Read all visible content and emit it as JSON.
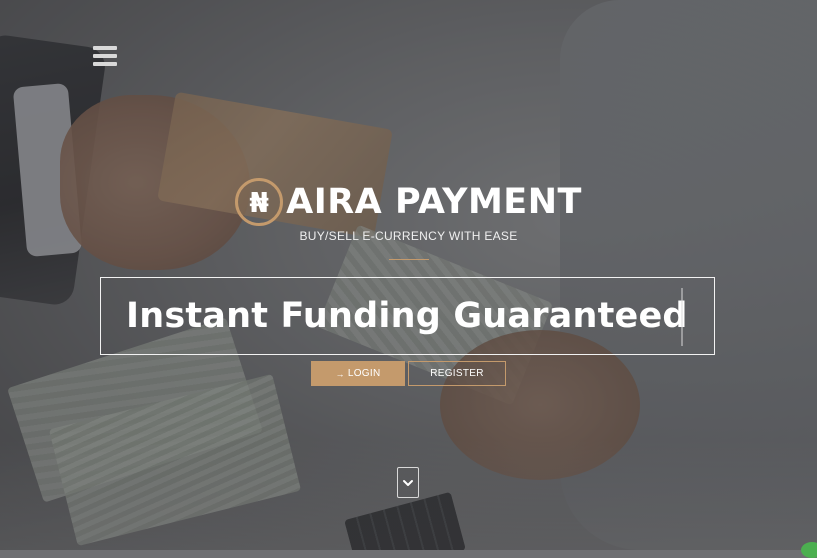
{
  "brand": {
    "logo_glyph": "₦",
    "name": "AIRA PAYMENT",
    "tagline": "BUY/SELL E-CURRENCY WITH EASE",
    "accent_color": "#c49a6c"
  },
  "hero": {
    "headline": "Instant Funding Guaranteed"
  },
  "buttons": {
    "login_icon": "→",
    "login_label": "LOGIN",
    "register_label": "REGISTER"
  },
  "icons": {
    "menu": "hamburger-menu-icon",
    "scroll": "chevron-down-icon",
    "login": "sign-in-icon"
  }
}
